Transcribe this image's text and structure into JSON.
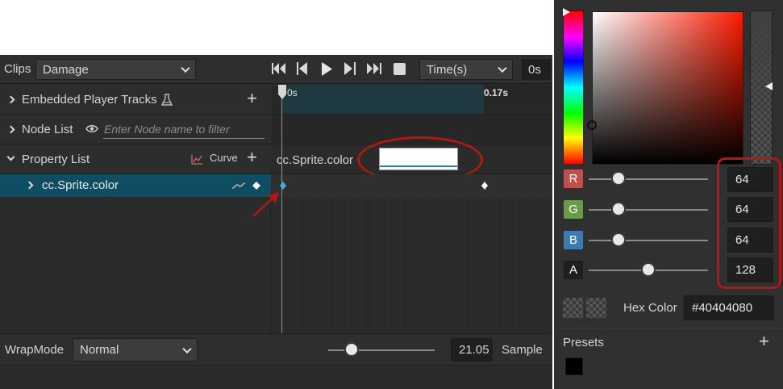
{
  "toolbar": {
    "clips_label": "Clips",
    "clip_value": "Damage",
    "time_unit_value": "Time(s)",
    "time_value": "0s"
  },
  "tracks": {
    "embedded_label": "Embedded Player Tracks",
    "node_list_label": "Node List",
    "node_filter_placeholder": "Enter Node name to filter",
    "property_list_label": "Property List",
    "curve_label": "Curve",
    "property_item_label": "cc.Sprite.color"
  },
  "timeline": {
    "start_label": "0s",
    "end_label": "0.17s",
    "property_header_label": "cc.Sprite.color"
  },
  "bottom": {
    "wrapmode_label": "WrapMode",
    "wrapmode_value": "Normal",
    "sample_value": "21.05",
    "sample_label": "Sample"
  },
  "picker": {
    "r_label": "R",
    "g_label": "G",
    "b_label": "B",
    "a_label": "A",
    "r_value": "64",
    "g_value": "64",
    "b_value": "64",
    "a_value": "128",
    "r_fraction": 0.251,
    "g_fraction": 0.251,
    "b_fraction": 0.251,
    "a_fraction": 0.502,
    "hex_label": "Hex Color",
    "hex_value": "#40404080",
    "presets_label": "Presets",
    "preset_color": "#000000",
    "colors": {
      "r_swatch": "#c0504d",
      "g_swatch": "#6a9a4a",
      "b_swatch": "#3d7ab0",
      "a_swatch": "#1e1e1e",
      "selection": "#0f4d63",
      "annotation": "#b01818"
    }
  },
  "icons": {
    "first_frame": "skip-first-icon",
    "prev_frame": "step-back-icon",
    "play": "play-icon",
    "next_frame": "step-forward-icon",
    "last_frame": "skip-last-icon",
    "stop": "stop-icon"
  }
}
